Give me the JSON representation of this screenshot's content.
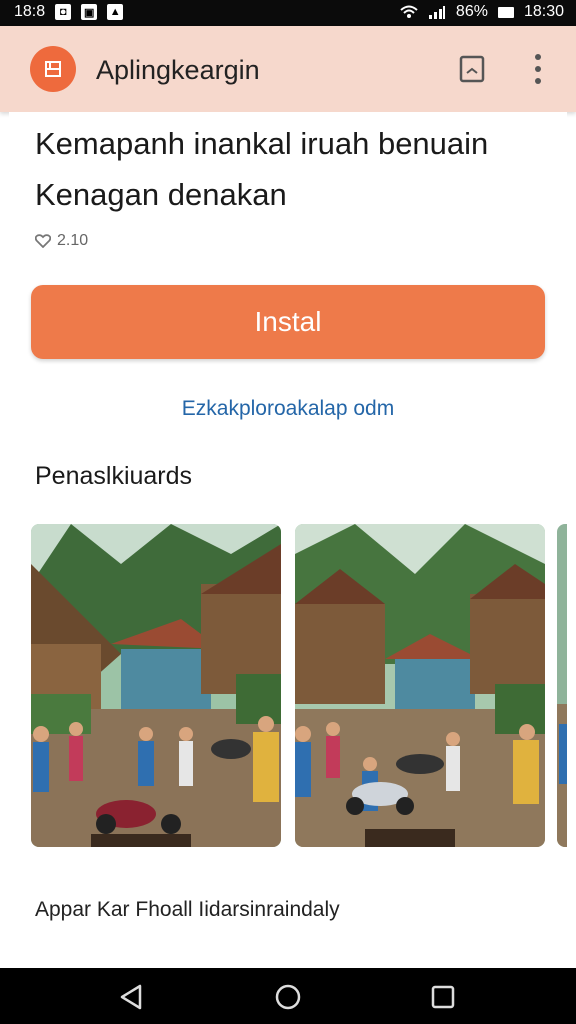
{
  "status_bar": {
    "time_left": "18:8",
    "time_right": "18:30",
    "signal_text": "86%"
  },
  "app_bar": {
    "title": "Aplingkeargin",
    "logo_icon": "app-logo-icon",
    "bookmark_icon": "bookmark-icon",
    "more_icon": "more-vert-icon"
  },
  "app": {
    "heading": "Kemapanh inankal iruah benuain Kenagan denakan",
    "rating": "2.10",
    "install_label": "Instal",
    "explore_label": "Ezkakploroakalap odm"
  },
  "screenshots_section": {
    "title": "Penaslkiuards",
    "items": [
      {
        "alt": "village-scene"
      },
      {
        "alt": "village-scene"
      },
      {
        "alt": "village-scene-partial"
      }
    ]
  },
  "details": {
    "text": "Appar Kar Fhoall Iidarsinraindaly"
  },
  "colors": {
    "accent": "#ee7a4a",
    "app_bar_bg": "#f6d8cc",
    "link": "#2466a8"
  }
}
